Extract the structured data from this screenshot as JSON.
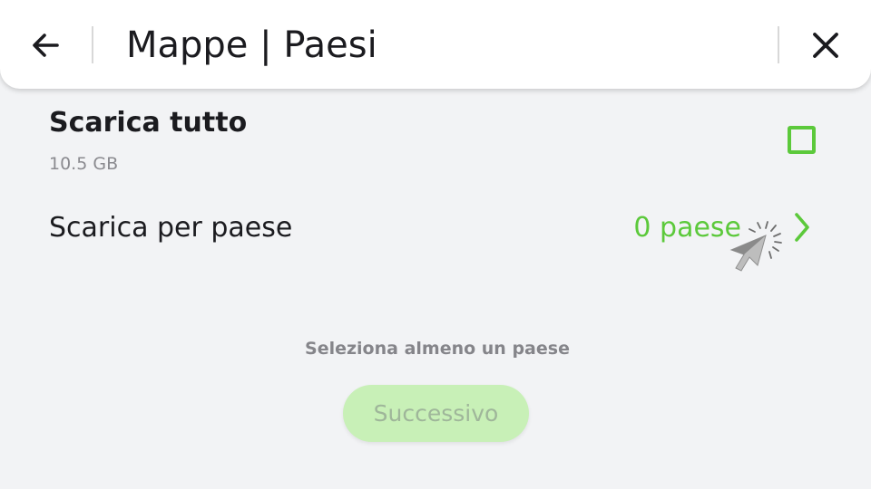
{
  "header": {
    "title": "Mappe | Paesi",
    "back_icon": "arrow-left-icon",
    "close_icon": "close-icon"
  },
  "download_all": {
    "title": "Scarica tutto",
    "size": "10.5 GB",
    "checked": false
  },
  "download_by_country": {
    "label": "Scarica per paese",
    "count": "0 paese",
    "chevron_icon": "chevron-right-icon"
  },
  "footer": {
    "hint": "Seleziona almeno un paese",
    "next_label": "Successivo",
    "next_enabled": false
  },
  "colors": {
    "accent": "#5cc93b",
    "background": "#f2f3f5",
    "header_bg": "#ffffff",
    "text_primary": "#1b1b1f",
    "text_secondary": "#8a8a8f",
    "button_disabled_bg": "#c8f0b7",
    "button_disabled_text": "#9fb69a"
  }
}
